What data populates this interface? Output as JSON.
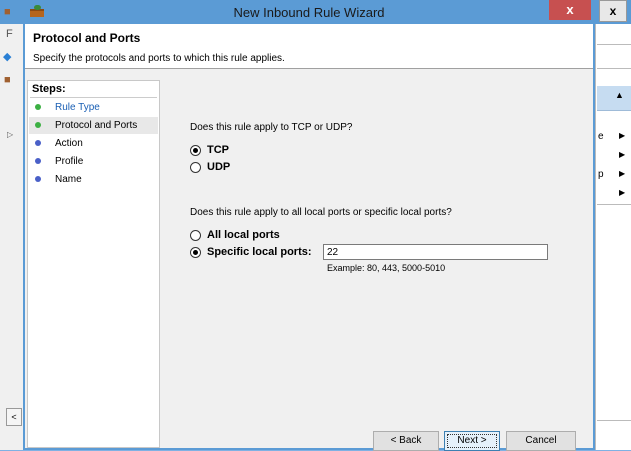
{
  "background_window": {
    "close_label": "x",
    "right_panel_items": [
      "e",
      "",
      "p",
      ""
    ]
  },
  "dialog": {
    "title": "New Inbound Rule Wizard",
    "close_label": "x",
    "header": {
      "title": "Protocol and Ports",
      "subtitle": "Specify the protocols and ports to which this rule applies."
    },
    "steps": {
      "title": "Steps:",
      "items": [
        {
          "label": "Rule Type",
          "state": "link",
          "dot_color": "#3cb043"
        },
        {
          "label": "Protocol and Ports",
          "state": "current",
          "dot_color": "#3cb043"
        },
        {
          "label": "Action",
          "state": "pending",
          "dot_color": "#4a60c8"
        },
        {
          "label": "Profile",
          "state": "pending",
          "dot_color": "#4a60c8"
        },
        {
          "label": "Name",
          "state": "pending",
          "dot_color": "#4a60c8"
        }
      ]
    },
    "protocol": {
      "question": "Does this rule apply to TCP or UDP?",
      "options": [
        {
          "label": "TCP",
          "selected": true
        },
        {
          "label": "UDP",
          "selected": false
        }
      ]
    },
    "ports": {
      "question": "Does this rule apply to all local ports or specific local ports?",
      "options": [
        {
          "label": "All local ports",
          "selected": false
        },
        {
          "label": "Specific local ports:",
          "selected": true
        }
      ],
      "value": "22",
      "example": "Example: 80, 443, 5000-5010"
    },
    "buttons": {
      "back": "< Back",
      "next": "Next >",
      "cancel": "Cancel"
    }
  }
}
